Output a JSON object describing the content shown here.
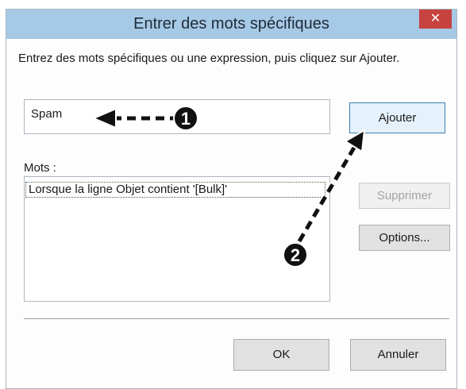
{
  "dialog": {
    "title": "Entrer des mots spécifiques",
    "close_label": "✕",
    "prompt": "Entrez des mots spécifiques ou une expression, puis cliquez sur Ajouter.",
    "input_value": "Spam",
    "words_label": "Mots :",
    "words": [
      "Lorsque la ligne Objet contient '[Bulk]'"
    ],
    "buttons": {
      "add": "Ajouter",
      "remove": "Supprimer",
      "options": "Options...",
      "ok": "OK",
      "cancel": "Annuler"
    }
  },
  "annotations": {
    "marker_1": "1",
    "marker_2": "2"
  },
  "colors": {
    "titlebar": "#a6c9e6",
    "close_button": "#c74340",
    "annotation": "#111111"
  }
}
